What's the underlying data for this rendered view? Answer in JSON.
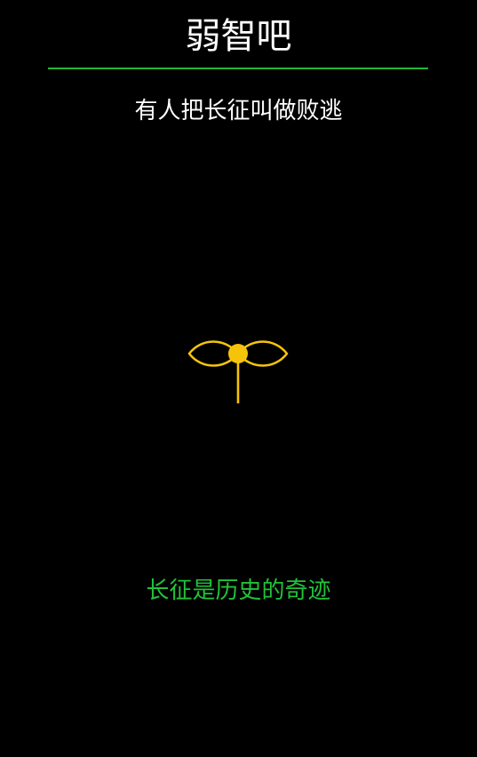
{
  "header": {
    "title": "弱智吧"
  },
  "question": {
    "text": "有人把长征叫做败逃"
  },
  "emblem": {
    "icon": "sprout-icon",
    "color": "#f5c40a"
  },
  "answer": {
    "text": "长征是历史的奇迹"
  },
  "colors": {
    "background": "#000000",
    "divider": "#22b83a",
    "answer_text": "#20c23a",
    "title_text": "#ffffff"
  }
}
